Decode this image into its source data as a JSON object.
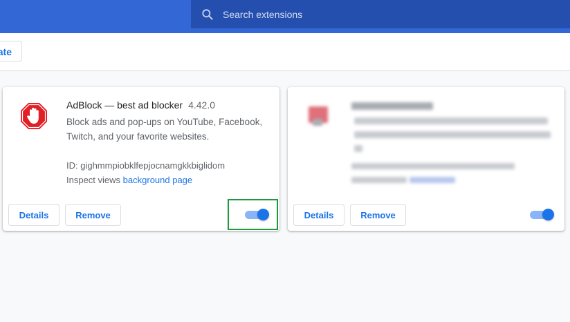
{
  "search": {
    "placeholder": "Search extensions"
  },
  "toolbar": {
    "update_label": "Update"
  },
  "extensions": [
    {
      "name": "AdBlock — best ad blocker",
      "version": "4.42.0",
      "description": "Block ads and pop-ups on YouTube, Facebook, Twitch, and your favorite websites.",
      "id_label": "ID: gighmmpiobklfepjocnamgkkbiglidom",
      "inspect_label": "Inspect views",
      "inspect_link": "background page",
      "details_label": "Details",
      "remove_label": "Remove",
      "enabled": true,
      "icon": "adblock-stop-hand-icon",
      "icon_color": "#e11f26"
    },
    {
      "details_label": "Details",
      "remove_label": "Remove",
      "enabled": true
    }
  ],
  "colors": {
    "header": "#3367d6",
    "search_bg": "#254fae",
    "accent": "#1a73e8",
    "highlight": "#1e9a3e"
  }
}
